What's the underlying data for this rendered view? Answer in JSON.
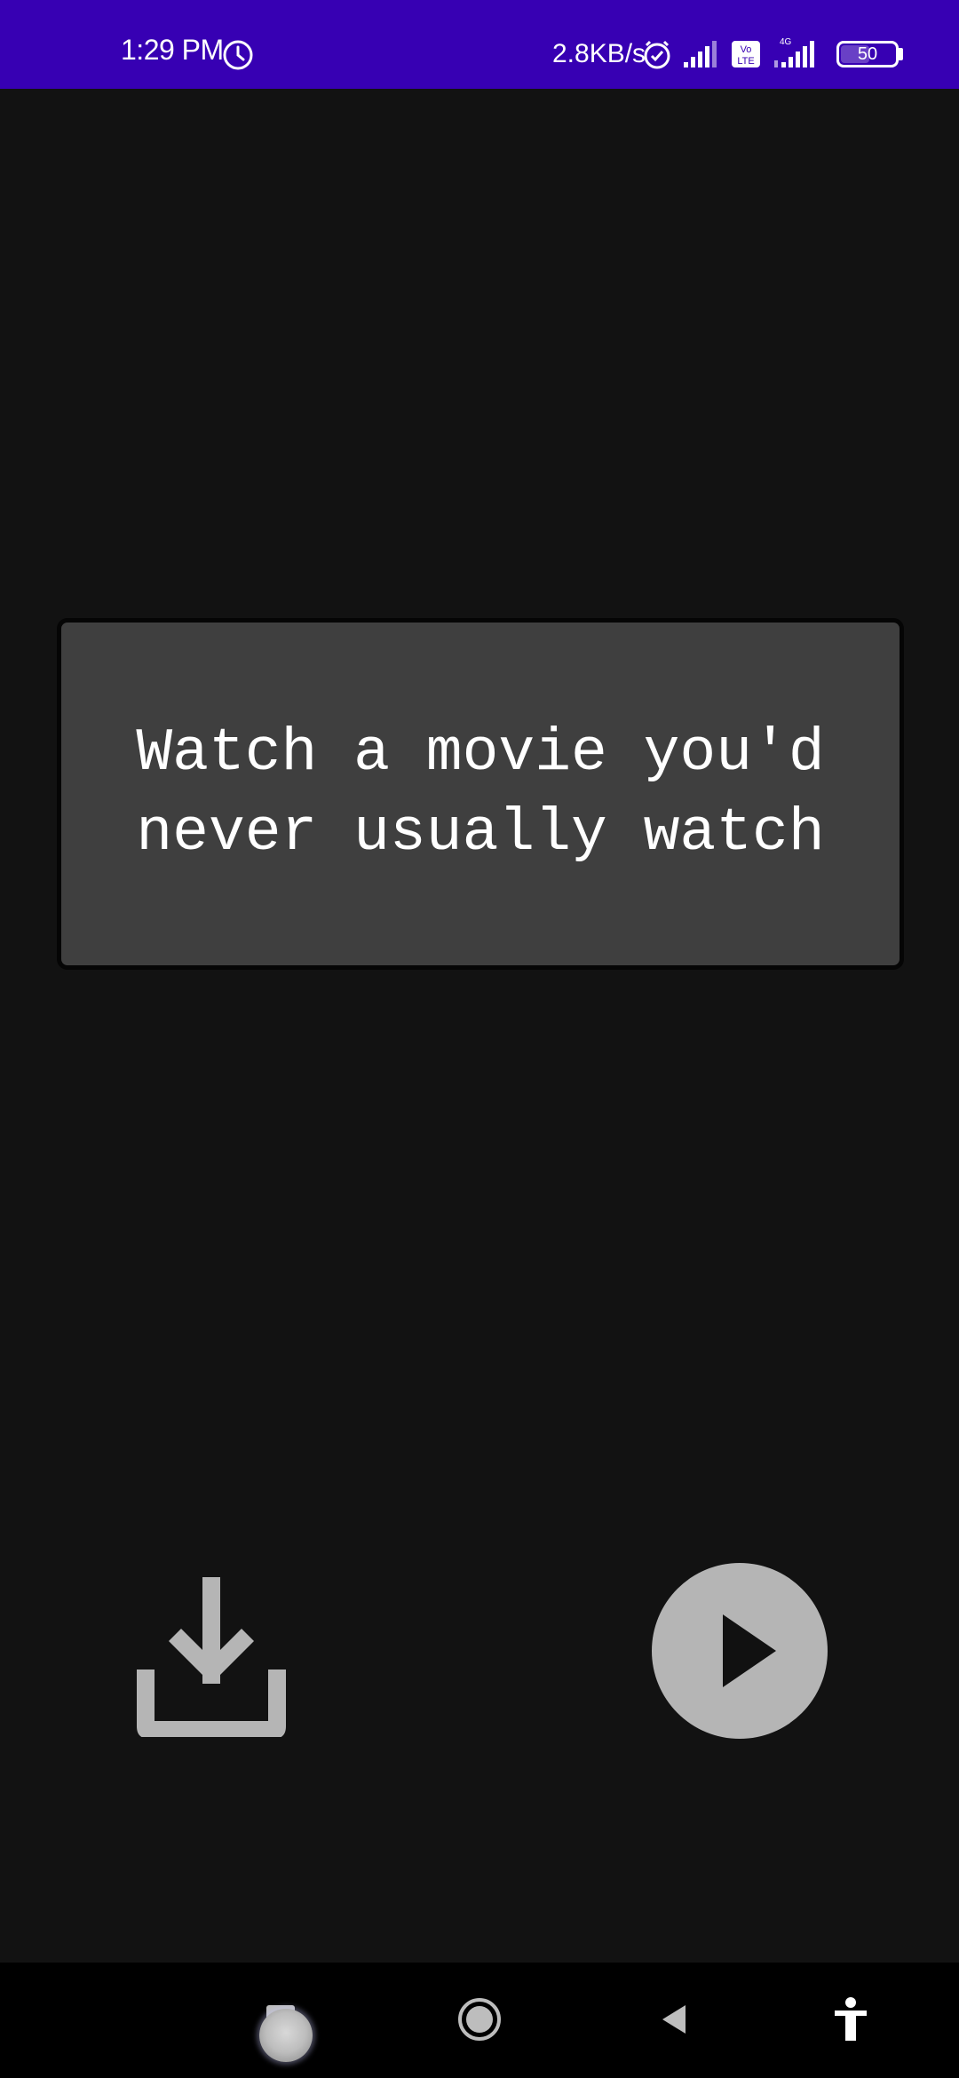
{
  "status_bar": {
    "time": "1:29 PM",
    "net_speed": "2.8KB/s",
    "battery_level": "50",
    "icons": [
      "clock-icon",
      "alarm-icon",
      "signal-icon",
      "volte-icon",
      "signal-4g-icon",
      "battery-icon"
    ],
    "background": "#3700b3"
  },
  "card": {
    "text": "Watch a movie you'd never usually watch",
    "background": "#3f3f3f"
  },
  "actions": {
    "download_icon": "download-icon",
    "play_icon": "play-icon",
    "icon_color": "#b5b5b5"
  },
  "nav_bar": {
    "items": [
      "recents-icon",
      "home-icon",
      "back-icon",
      "accessibility-icon"
    ]
  },
  "theme": {
    "background": "#121212"
  }
}
